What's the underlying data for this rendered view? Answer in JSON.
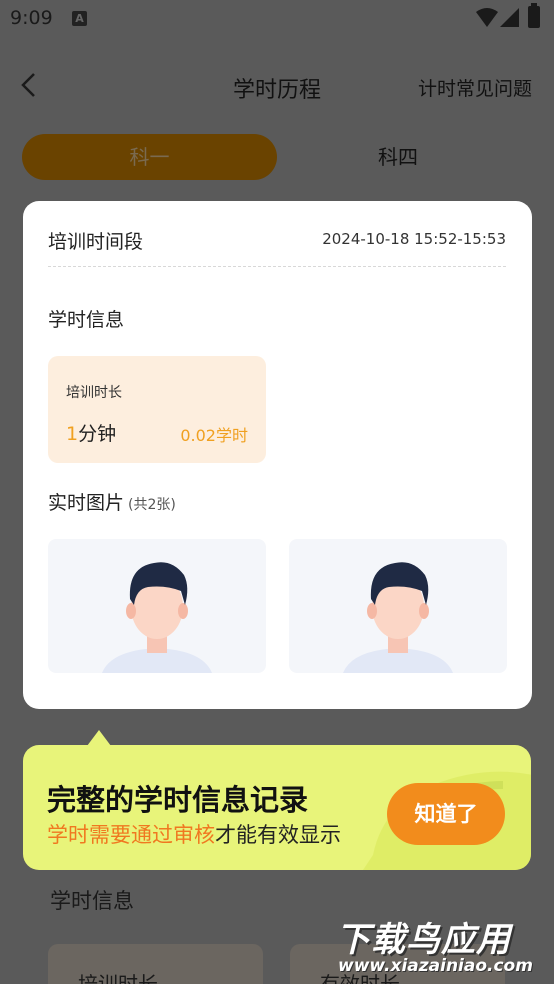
{
  "status_bar": {
    "time": "9:09",
    "app_icon": "A"
  },
  "nav": {
    "title": "学时历程",
    "faq": "计时常见问题"
  },
  "subjects": [
    {
      "label": "科一",
      "active": true
    },
    {
      "label": "科四",
      "active": false
    }
  ],
  "card": {
    "period_label": "培训时间段",
    "period_value": "2024-10-18 15:52-15:53",
    "info_title": "学时信息",
    "duration": {
      "label": "培训时长",
      "minutes_num": "1",
      "minutes_unit": "分钟",
      "hours": "0.02学时"
    },
    "photos_title": "实时图片",
    "photos_count": "(共2张)"
  },
  "tip": {
    "headline": "完整的学时信息记录",
    "sub_highlight": "学时需要通过审核",
    "sub_rest": "才能有效显示",
    "button": "知道了"
  },
  "background": {
    "section_title": "学时信息",
    "box1": "培训时长",
    "box2": "有效时长"
  },
  "watermark": {
    "title": "下载鸟应用",
    "url": "www.xiazainiao.com"
  },
  "colors": {
    "accent_orange": "#f28c1c",
    "tip_bg": "#e8f47a",
    "duration_bg": "#fdeede"
  }
}
